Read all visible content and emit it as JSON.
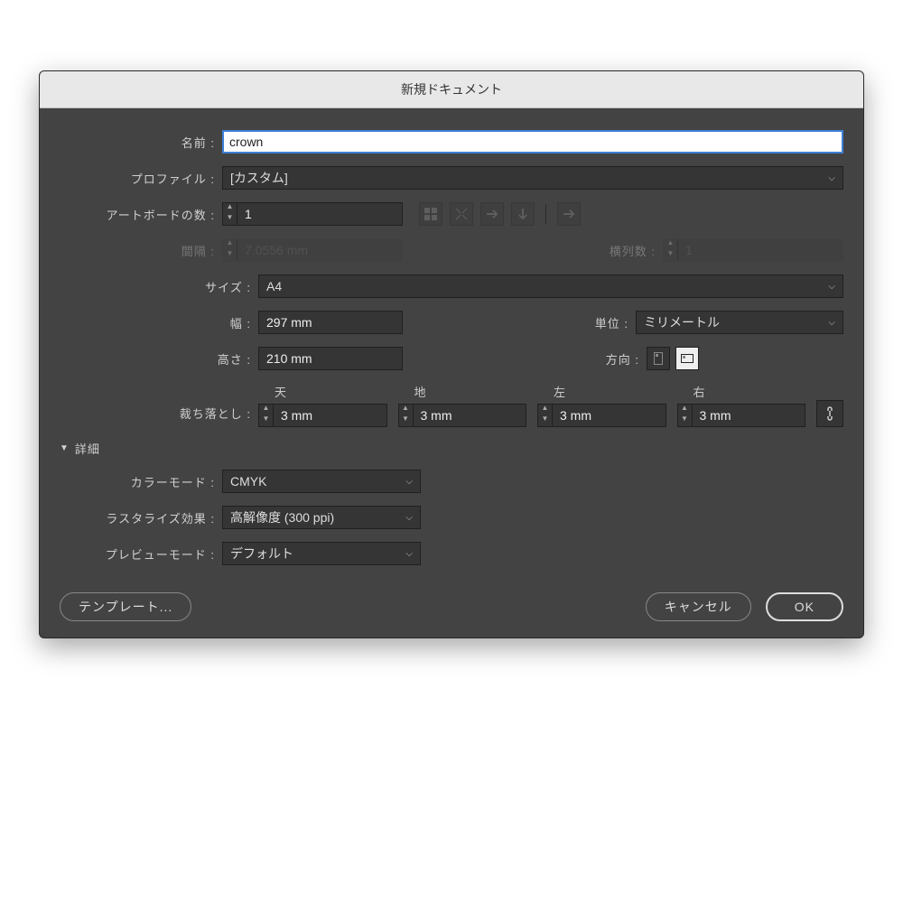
{
  "title": "新規ドキュメント",
  "labels": {
    "name": "名前 :",
    "profile": "プロファイル :",
    "artboards": "アートボードの数 :",
    "spacing": "間隔 :",
    "columns": "横列数 :",
    "size": "サイズ :",
    "width": "幅 :",
    "height": "高さ :",
    "units": "単位 :",
    "orientation": "方向 :",
    "bleed": "裁ち落とし :",
    "top": "天",
    "bottom": "地",
    "left": "左",
    "right": "右",
    "advanced": "詳細",
    "colorMode": "カラーモード :",
    "raster": "ラスタライズ効果 :",
    "preview": "プレビューモード :"
  },
  "values": {
    "name": "crown",
    "profile": "[カスタム]",
    "artboards": "1",
    "spacing": "7.0556 mm",
    "columns": "1",
    "size": "A4",
    "width": "297 mm",
    "height": "210 mm",
    "units": "ミリメートル",
    "bleedTop": "3 mm",
    "bleedBottom": "3 mm",
    "bleedLeft": "3 mm",
    "bleedRight": "3 mm",
    "colorMode": "CMYK",
    "raster": "高解像度 (300 ppi)",
    "preview": "デフォルト"
  },
  "buttons": {
    "templates": "テンプレート...",
    "cancel": "キャンセル",
    "ok": "OK"
  }
}
